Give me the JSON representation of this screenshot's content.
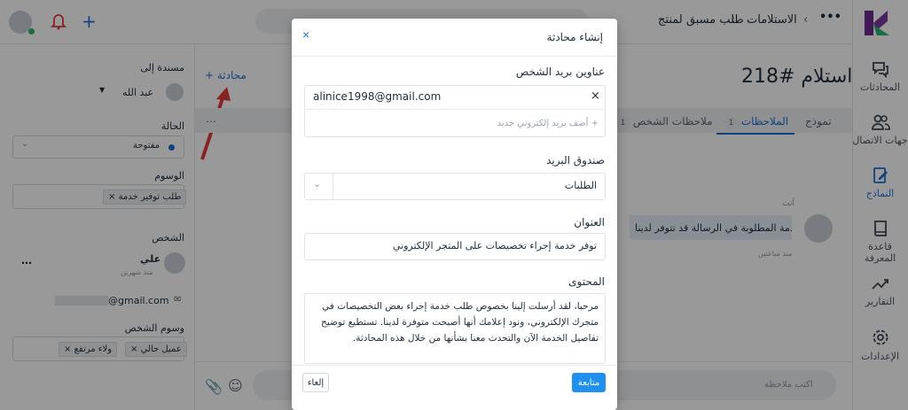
{
  "nav": {
    "items": [
      {
        "label": "المحادثات",
        "icon": "chat-icon"
      },
      {
        "label": "جهات الاتصال",
        "icon": "contacts-icon"
      },
      {
        "label": "النماذج",
        "icon": "forms-icon"
      },
      {
        "label": "قاعدة المعرفة",
        "icon": "book-icon"
      },
      {
        "label": "التقارير",
        "icon": "reports-icon"
      },
      {
        "label": "الإعدادات",
        "icon": "gear-icon"
      }
    ]
  },
  "topbar": {
    "crumb1": "الاستلامات",
    "crumb2": "طلب مسبق لمنتج"
  },
  "page": {
    "title": "استلام #218",
    "new_conversation": "محادثة",
    "tabs": [
      {
        "label": "نموذج"
      },
      {
        "label": "الملاحظات",
        "count": "1"
      },
      {
        "label": "ملاحظات الشخص",
        "count": "1"
      }
    ],
    "note": {
      "author": "أنت",
      "text": "الخدمة المطلوبة في الرسالة قد تتوفر لدينا",
      "time": "منذ ساعتين"
    },
    "composer_placeholder": "اكتب ملاحظة"
  },
  "left": {
    "assigned_label": "مسندة إلى",
    "assignee": "عبد الله",
    "status_label": "الحالة",
    "status": "مفتوحة",
    "tags_label": "الوسوم",
    "tag": "طلب توفير خدمة",
    "person_label": "الشخص",
    "person_name": "علي",
    "person_since": "منذ شهرين",
    "email_suffix": "@gmail.com",
    "person_tags_label": "وسوم الشخص",
    "person_tags": [
      "عميل حالي",
      "ولاء مرتفع"
    ]
  },
  "modal": {
    "title": "إنشاء محادثة",
    "emails_label": "عناوين بريد الشخص",
    "email": "alinice1998@gmail.com",
    "add_email_placeholder": "أضف بريد إلكتروني جديد",
    "mailbox_label": "صندوق البريد",
    "mailbox": "الطلبات",
    "subject_label": "العنوان",
    "subject": "توفر خدمة إجراء تخصيصات على المتجر الإلكتروني",
    "content_label": "المحتوى",
    "content": "مرحبا، لقد أرسلت إلينا بخصوص طلب خدمة إجراء بعض التخصيصات في متجرك الإلكتروني، ونود إعلامك أنها أصبحت متوفرة لدينا. تستطيع توضيح تفاصيل الخدمة الآن والتحدث معنا بشأنها من خلال هذه المحادثة.",
    "continue": "متابعة",
    "cancel": "إلغاء"
  },
  "colors": {
    "accent": "#1f6fd0",
    "annotation_arrow": "#e23b3b",
    "status_dot": "#1f6fd0"
  }
}
